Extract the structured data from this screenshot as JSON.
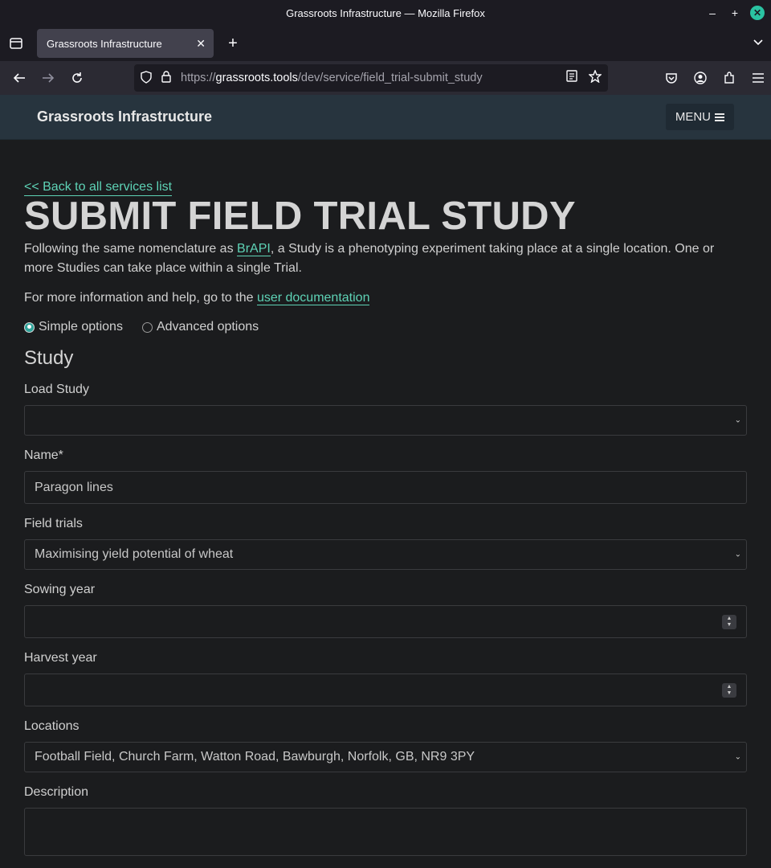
{
  "window": {
    "title": "Grassroots Infrastructure — Mozilla Firefox"
  },
  "browser": {
    "tab_title": "Grassroots Infrastructure",
    "url_prefix": "https://",
    "url_host": "grassroots.tools",
    "url_path": "/dev/service/field_trial-submit_study"
  },
  "site": {
    "brand": "Grassroots Infrastructure",
    "menu_label": "MENU"
  },
  "page": {
    "back_link": "<< Back to all services list",
    "title": "SUBMIT FIELD TRIAL STUDY",
    "intro_before": "Following the same nomenclature as ",
    "intro_link": "BrAPI",
    "intro_after": ", a Study is a phenotyping experiment taking place at a single location. One or more Studies can take place within a single Trial.",
    "more_before": "For more information and help, go to the ",
    "more_link": "user documentation",
    "option_simple": "Simple options",
    "option_advanced": "Advanced options",
    "section_title": "Study"
  },
  "form": {
    "load_study": {
      "label": "Load Study",
      "value": ""
    },
    "name": {
      "label": "Name*",
      "value": "Paragon lines"
    },
    "field_trials": {
      "label": "Field trials",
      "value": "Maximising yield potential of wheat"
    },
    "sowing_year": {
      "label": "Sowing year",
      "value": ""
    },
    "harvest_year": {
      "label": "Harvest year",
      "value": ""
    },
    "locations": {
      "label": "Locations",
      "value": "Football Field, Church Farm, Watton Road, Bawburgh, Norfolk, GB, NR9 3PY"
    },
    "description": {
      "label": "Description",
      "value": ""
    }
  }
}
